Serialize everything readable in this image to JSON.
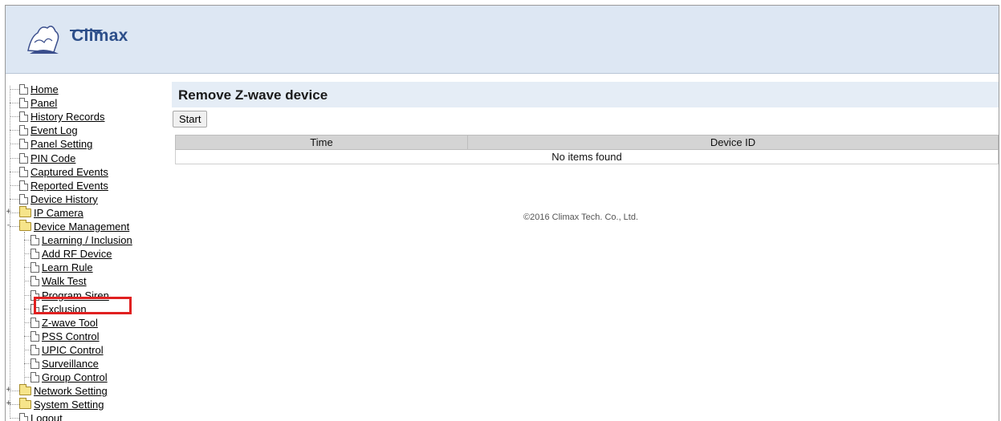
{
  "header": {
    "logo_text": "Climax"
  },
  "sidebar": {
    "items": [
      {
        "label": "Home",
        "type": "page"
      },
      {
        "label": "Panel",
        "type": "page"
      },
      {
        "label": "History Records",
        "type": "page"
      },
      {
        "label": "Event Log",
        "type": "page"
      },
      {
        "label": "Panel Setting",
        "type": "page"
      },
      {
        "label": "PIN Code",
        "type": "page"
      },
      {
        "label": "Captured Events",
        "type": "page"
      },
      {
        "label": "Reported Events",
        "type": "page"
      },
      {
        "label": "Device History",
        "type": "page"
      },
      {
        "label": "IP Camera",
        "type": "folder",
        "expand": "+"
      },
      {
        "label": "Device Management",
        "type": "folder",
        "expand": "-"
      },
      {
        "label": "Learning / Inclusion",
        "type": "page"
      },
      {
        "label": "Add RF Device",
        "type": "page"
      },
      {
        "label": "Learn Rule",
        "type": "page"
      },
      {
        "label": "Walk Test",
        "type": "page"
      },
      {
        "label": "Program Siren",
        "type": "page"
      },
      {
        "label": "Exclusion",
        "type": "page",
        "selected": true
      },
      {
        "label": "Z-wave Tool",
        "type": "page"
      },
      {
        "label": "PSS Control",
        "type": "page"
      },
      {
        "label": "UPIC Control",
        "type": "page"
      },
      {
        "label": "Surveillance",
        "type": "page"
      },
      {
        "label": "Group Control",
        "type": "page"
      },
      {
        "label": "Network Setting",
        "type": "folder",
        "expand": "+"
      },
      {
        "label": "System Setting",
        "type": "folder",
        "expand": "+"
      },
      {
        "label": "Logout",
        "type": "page"
      }
    ]
  },
  "main": {
    "title": "Remove Z-wave device",
    "start_label": "Start",
    "table": {
      "columns": [
        "Time",
        "Device ID"
      ],
      "empty_message": "No items found"
    }
  },
  "footer": {
    "copyright": "©2016 Climax Tech. Co., Ltd."
  },
  "colors": {
    "highlight": "#e02020",
    "header_bg": "#dde7f3",
    "title_bg": "#e5edf6"
  }
}
